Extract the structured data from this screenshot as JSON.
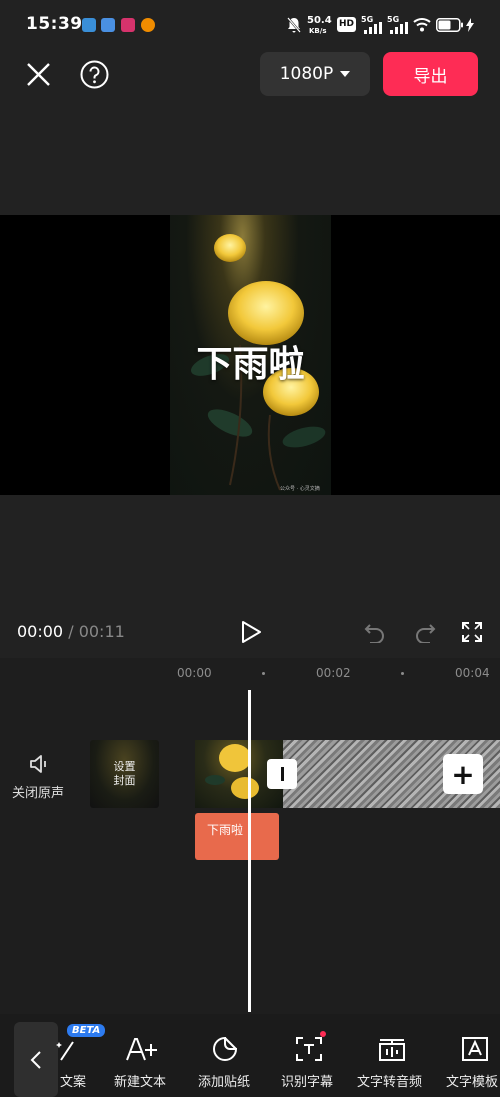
{
  "status_bar": {
    "time": "15:39",
    "net_speed_value": "50.4",
    "net_speed_unit": "KB/s",
    "hd_label": "HD",
    "signal1_label": "5G",
    "signal2_label": "5G"
  },
  "top_bar": {
    "resolution_label": "1080P",
    "export_label": "导出"
  },
  "preview": {
    "overlay_text": "下雨啦",
    "watermark": "公众号 · 心灵文摘"
  },
  "playback": {
    "current_time": "00:00",
    "separator": "/",
    "total_time": "00:11"
  },
  "timeline": {
    "ticks": [
      "00:00",
      "00:02",
      "00:04"
    ],
    "mute_label": "关闭原声",
    "cover_label_line1": "设置",
    "cover_label_line2": "封面",
    "text_clip_label": "下雨啦",
    "add_clip_symbol": "+"
  },
  "toolbar": {
    "beta_badge": "BETA",
    "items": [
      {
        "label": "文案",
        "icon": "magic-wand-icon"
      },
      {
        "label": "新建文本",
        "icon": "new-text-icon"
      },
      {
        "label": "添加贴纸",
        "icon": "sticker-icon"
      },
      {
        "label": "识别字幕",
        "icon": "caption-recognize-icon"
      },
      {
        "label": "文字转音频",
        "icon": "text-to-audio-icon"
      },
      {
        "label": "文字模板",
        "icon": "text-template-icon"
      }
    ]
  },
  "colors": {
    "export_accent": "#fe2c55",
    "text_clip": "#e86a4c",
    "beta_badge": "#2d7bf0"
  }
}
